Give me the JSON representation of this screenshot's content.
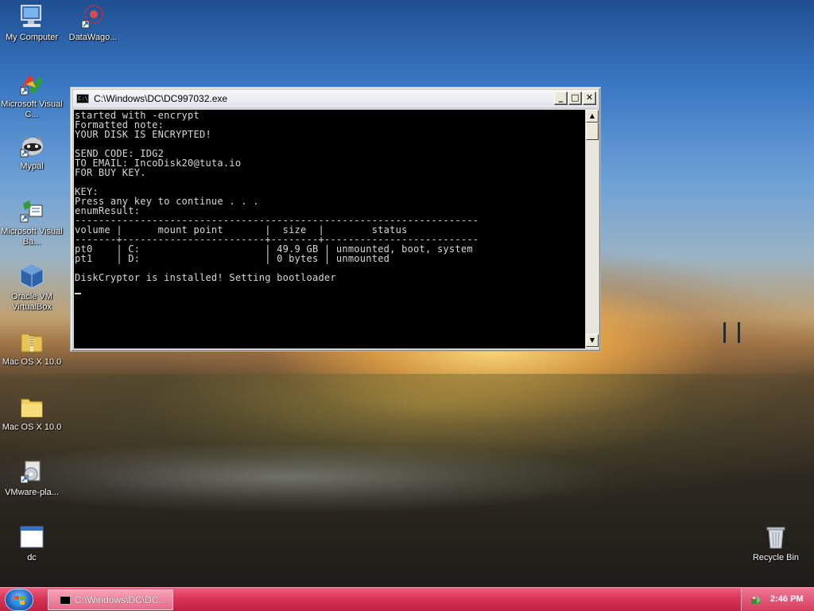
{
  "desktop": {
    "icons": [
      {
        "label": "My Computer"
      },
      {
        "label": "DataWago..."
      },
      {
        "label": "Microsoft Visual C..."
      },
      {
        "label": "Mypal"
      },
      {
        "label": "Microsoft Visual Ba..."
      },
      {
        "label": "Oracle VM VirtualBox"
      },
      {
        "label": "Mac OS X 10.0"
      },
      {
        "label": "Mac OS X 10.0"
      },
      {
        "label": "VMware-pla..."
      },
      {
        "label": "dc"
      },
      {
        "label": "Recycle Bin"
      }
    ]
  },
  "console_window": {
    "title": "C:\\Windows\\DC\\DC997032.exe",
    "buttons": {
      "minimize": "_",
      "maximize": "□",
      "close": "✕"
    },
    "output": "started with -encrypt\nFormatted note:\nYOUR DISK IS ENCRYPTED!\n\nSEND CODE: IDG2\nTO EMAIL: IncoDisk20@tuta.io\nFOR BUY KEY.\n\nKEY:\nPress any key to continue . . .\nenumResult:\n--------------------------------------------------------------------\nvolume |      mount point       |  size  |        status\n-------+------------------------+--------+--------------------------\npt0    | C:                     | 49.9 GB | unmounted, boot, system\npt1    | D:                     | 0 bytes | unmounted\n\nDiskCryptor is installed! Setting bootloader"
  },
  "taskbar": {
    "task_label": "C:\\Windows\\DC\\DC...",
    "clock": "2:46 PM"
  }
}
